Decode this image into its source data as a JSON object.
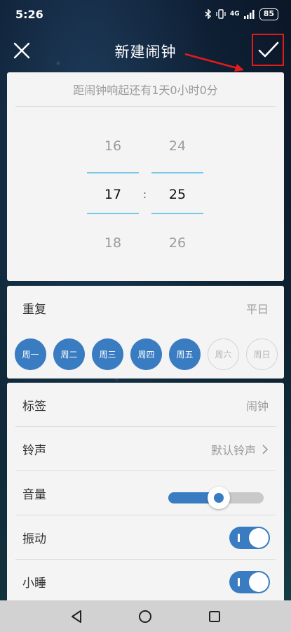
{
  "status_bar": {
    "time": "5:26",
    "battery": "85",
    "network": "4G"
  },
  "header": {
    "title": "新建闹钟"
  },
  "countdown": "距闹钟响起还有1天0小时0分",
  "picker": {
    "hours": [
      "16",
      "17",
      "18"
    ],
    "minutes": [
      "24",
      "25",
      "26"
    ],
    "separator": ":"
  },
  "repeat": {
    "label": "重复",
    "value": "平日",
    "days": [
      {
        "label": "周一",
        "on": true
      },
      {
        "label": "周二",
        "on": true
      },
      {
        "label": "周三",
        "on": true
      },
      {
        "label": "周四",
        "on": true
      },
      {
        "label": "周五",
        "on": true
      },
      {
        "label": "周六",
        "on": false
      },
      {
        "label": "周日",
        "on": false
      }
    ]
  },
  "settings": {
    "tag_label": "标签",
    "tag_value": "闹钟",
    "ringtone_label": "铃声",
    "ringtone_value": "默认铃声",
    "volume_label": "音量",
    "volume_level": 0.53,
    "vibrate_label": "振动",
    "vibrate_on": true,
    "snooze_label": "小睡",
    "snooze_on": true
  },
  "colors": {
    "accent": "#3a7cc2",
    "highlight_box": "#e31b1b",
    "picker_line": "#79c7e8"
  }
}
